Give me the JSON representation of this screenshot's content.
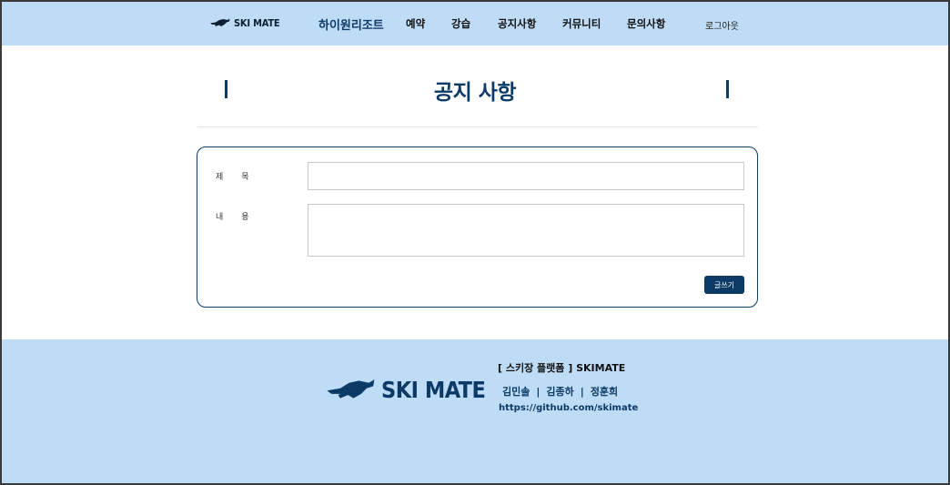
{
  "header": {
    "logo_text": "SKI MATE",
    "nav": {
      "resort": "하이원리조트",
      "reserve": "예약",
      "lesson": "강습",
      "notice": "공지사항",
      "community": "커뮤니티",
      "inquiry": "문의사항",
      "logout": "로그아웃"
    }
  },
  "page": {
    "title": "공지 사항"
  },
  "form": {
    "title_label": "제목",
    "content_label": "내용",
    "title_value": "",
    "content_value": "",
    "submit_label": "글쓰기"
  },
  "footer": {
    "logo_text": "SKI MATE",
    "platform": "[ 스키장 플랫폼 ]   SKIMATE",
    "members": [
      "김민솔",
      "김종하",
      "정훈희"
    ],
    "separator": "|",
    "link": "https://github.com/skimate"
  },
  "colors": {
    "header_bg": "#bfdcf7",
    "primary": "#0b3a66",
    "footer_bg": "#bfdcf7"
  }
}
